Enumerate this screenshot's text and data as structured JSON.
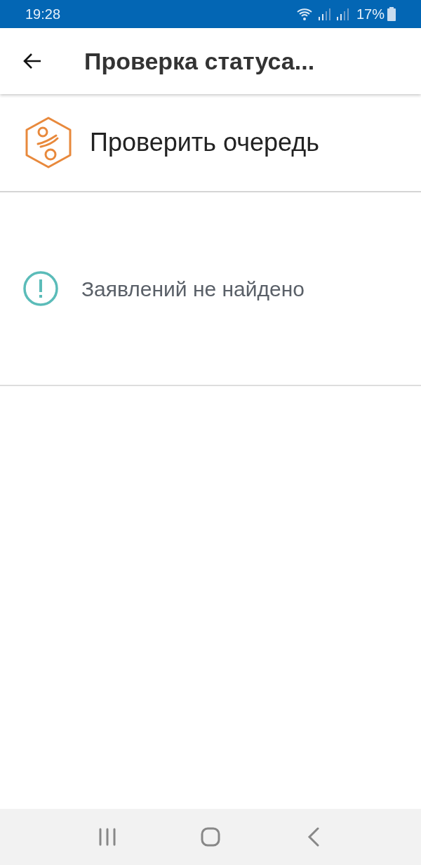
{
  "status_bar": {
    "time": "19:28",
    "battery": "17%"
  },
  "app_bar": {
    "title": "Проверка статуса..."
  },
  "header": {
    "title": "Проверить очередь"
  },
  "message": {
    "text": "Заявлений не найдено"
  }
}
